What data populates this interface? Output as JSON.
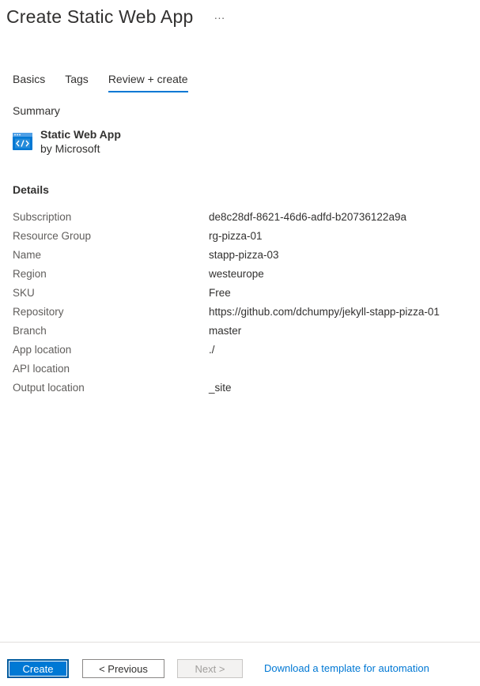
{
  "header": {
    "title": "Create Static Web App",
    "more_glyph": "···"
  },
  "tabs": [
    {
      "label": "Basics",
      "active": false
    },
    {
      "label": "Tags",
      "active": false
    },
    {
      "label": "Review + create",
      "active": true
    }
  ],
  "summary": {
    "heading": "Summary",
    "product_name": "Static Web App",
    "publisher": "by Microsoft",
    "icon": "static-web-app-icon"
  },
  "details": {
    "heading": "Details",
    "rows": [
      {
        "label": "Subscription",
        "value": "de8c28df-8621-46d6-adfd-b20736122a9a"
      },
      {
        "label": "Resource Group",
        "value": "rg-pizza-01"
      },
      {
        "label": "Name",
        "value": "stapp-pizza-03"
      },
      {
        "label": "Region",
        "value": "westeurope"
      },
      {
        "label": "SKU",
        "value": "Free"
      },
      {
        "label": "Repository",
        "value": "https://github.com/dchumpy/jekyll-stapp-pizza-01"
      },
      {
        "label": "Branch",
        "value": "master"
      },
      {
        "label": "App location",
        "value": "./"
      },
      {
        "label": "API location",
        "value": ""
      },
      {
        "label": "Output location",
        "value": "_site"
      }
    ]
  },
  "footer": {
    "create_label": "Create",
    "previous_label": "< Previous",
    "next_label": "Next >",
    "automation_link": "Download a template for automation"
  },
  "colors": {
    "accent": "#0078d4",
    "text": "#323130",
    "muted": "#605e5c"
  }
}
